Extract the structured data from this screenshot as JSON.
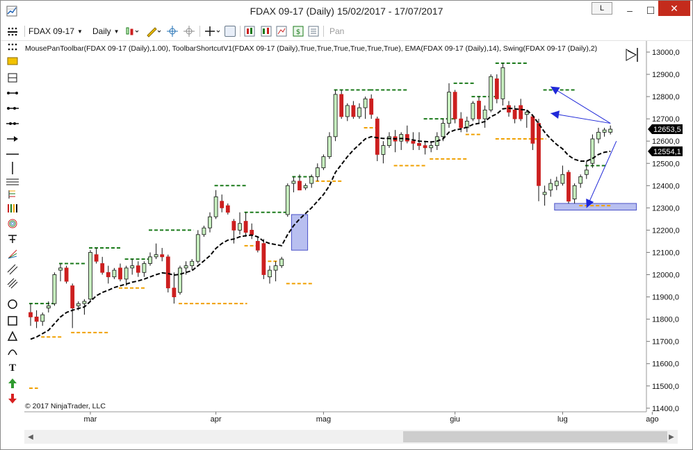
{
  "window": {
    "title": "FDAX 09-17 (Daily)  15/02/2017 - 17/07/2017",
    "btn_l": "L",
    "minimize": "–",
    "maximize": "☐",
    "close": "✕"
  },
  "toolbar": {
    "instrument": "FDAX 09-17",
    "period": "Daily",
    "pan": "Pan"
  },
  "chart": {
    "indicators": "MousePanToolbar(FDAX 09-17 (Daily),1.00), ToolbarShortcutV1(FDAX 09-17 (Daily),True,True,True,True,True,True), EMA(FDAX 09-17 (Daily),14), Swing(FDAX 09-17 (Daily),2)",
    "copyright": "© 2017 NinjaTrader, LLC",
    "price_ticks": [
      "13000,0",
      "12900,0",
      "12800,0",
      "12700,0",
      "12600,0",
      "12500,0",
      "12400,0",
      "12300,0",
      "12200,0",
      "12100,0",
      "12000,0",
      "11900,0",
      "11800,0",
      "11700,0",
      "11600,0",
      "11500,0",
      "11400,0"
    ],
    "month_labels": [
      "mar",
      "apr",
      "mag",
      "giu",
      "lug",
      "ago"
    ],
    "last_price_label": "12653,5",
    "ema_label": "12554,1",
    "colors": {
      "up_candle": "#c8f0c0",
      "down_candle": "#cc1f1f",
      "swing_high": "#1a7a1a",
      "swing_low": "#f0a000",
      "ema": "#000000",
      "annotation": "#1f28d8",
      "box": "#b8bff0",
      "price_marker": "#000000"
    }
  },
  "chart_data": {
    "type": "candlestick",
    "x_range": [
      "15/02/2017",
      "17/07/2017"
    ],
    "ylim": [
      11400,
      13030
    ],
    "candles": [
      {
        "o": 11830,
        "h": 11870,
        "l": 11770,
        "c": 11810
      },
      {
        "o": 11810,
        "h": 11840,
        "l": 11760,
        "c": 11790
      },
      {
        "o": 11790,
        "h": 11830,
        "l": 11770,
        "c": 11820
      },
      {
        "o": 11850,
        "h": 11880,
        "l": 11830,
        "c": 11860
      },
      {
        "o": 11870,
        "h": 12010,
        "l": 11860,
        "c": 12000
      },
      {
        "o": 12020,
        "h": 12050,
        "l": 11970,
        "c": 12030
      },
      {
        "o": 12030,
        "h": 12040,
        "l": 11960,
        "c": 11970
      },
      {
        "o": 11950,
        "h": 11960,
        "l": 11760,
        "c": 11850
      },
      {
        "o": 11860,
        "h": 11880,
        "l": 11840,
        "c": 11870
      },
      {
        "o": 11870,
        "h": 11890,
        "l": 11820,
        "c": 11880
      },
      {
        "o": 11890,
        "h": 12110,
        "l": 11880,
        "c": 12100
      },
      {
        "o": 12090,
        "h": 12120,
        "l": 12050,
        "c": 12060
      },
      {
        "o": 12050,
        "h": 12080,
        "l": 12000,
        "c": 12010
      },
      {
        "o": 12010,
        "h": 12040,
        "l": 11960,
        "c": 11990
      },
      {
        "o": 11990,
        "h": 12030,
        "l": 11980,
        "c": 12020
      },
      {
        "o": 12030,
        "h": 12050,
        "l": 11970,
        "c": 11980
      },
      {
        "o": 11980,
        "h": 12040,
        "l": 11950,
        "c": 12030
      },
      {
        "o": 12030,
        "h": 12070,
        "l": 12000,
        "c": 12040
      },
      {
        "o": 12040,
        "h": 12060,
        "l": 11990,
        "c": 12010
      },
      {
        "o": 12010,
        "h": 12060,
        "l": 11990,
        "c": 12050
      },
      {
        "o": 12050,
        "h": 12100,
        "l": 12040,
        "c": 12080
      },
      {
        "o": 12080,
        "h": 12140,
        "l": 12070,
        "c": 12090
      },
      {
        "o": 12090,
        "h": 12120,
        "l": 12060,
        "c": 12080
      },
      {
        "o": 12080,
        "h": 12090,
        "l": 11920,
        "c": 11940
      },
      {
        "o": 11940,
        "h": 12010,
        "l": 11870,
        "c": 11900
      },
      {
        "o": 11920,
        "h": 12040,
        "l": 11910,
        "c": 12030
      },
      {
        "o": 12030,
        "h": 12060,
        "l": 12000,
        "c": 12040
      },
      {
        "o": 12040,
        "h": 12070,
        "l": 12020,
        "c": 12060
      },
      {
        "o": 12060,
        "h": 12200,
        "l": 12050,
        "c": 12180
      },
      {
        "o": 12180,
        "h": 12220,
        "l": 12170,
        "c": 12210
      },
      {
        "o": 12210,
        "h": 12280,
        "l": 12190,
        "c": 12260
      },
      {
        "o": 12260,
        "h": 12380,
        "l": 12250,
        "c": 12350
      },
      {
        "o": 12330,
        "h": 12360,
        "l": 12280,
        "c": 12300
      },
      {
        "o": 12310,
        "h": 12320,
        "l": 12270,
        "c": 12280
      },
      {
        "o": 12240,
        "h": 12250,
        "l": 12140,
        "c": 12200
      },
      {
        "o": 12200,
        "h": 12280,
        "l": 12180,
        "c": 12230
      },
      {
        "o": 12240,
        "h": 12280,
        "l": 12170,
        "c": 12190
      },
      {
        "o": 12200,
        "h": 12230,
        "l": 12160,
        "c": 12180
      },
      {
        "o": 12150,
        "h": 12170,
        "l": 12100,
        "c": 12110
      },
      {
        "o": 12140,
        "h": 12160,
        "l": 11980,
        "c": 12000
      },
      {
        "o": 11990,
        "h": 12040,
        "l": 11960,
        "c": 12020
      },
      {
        "o": 12020,
        "h": 12060,
        "l": 11970,
        "c": 12040
      },
      {
        "o": 12040,
        "h": 12080,
        "l": 12030,
        "c": 12070
      },
      {
        "o": 12270,
        "h": 12410,
        "l": 12260,
        "c": 12400
      },
      {
        "o": 12410,
        "h": 12440,
        "l": 12370,
        "c": 12420
      },
      {
        "o": 12420,
        "h": 12450,
        "l": 12380,
        "c": 12380
      },
      {
        "o": 12390,
        "h": 12410,
        "l": 12380,
        "c": 12400
      },
      {
        "o": 12410,
        "h": 12450,
        "l": 12390,
        "c": 12440
      },
      {
        "o": 12440,
        "h": 12500,
        "l": 12420,
        "c": 12480
      },
      {
        "o": 12480,
        "h": 12540,
        "l": 12470,
        "c": 12530
      },
      {
        "o": 12530,
        "h": 12640,
        "l": 12520,
        "c": 12620
      },
      {
        "o": 12620,
        "h": 12830,
        "l": 12600,
        "c": 12810
      },
      {
        "o": 12810,
        "h": 12830,
        "l": 12700,
        "c": 12710
      },
      {
        "o": 12710,
        "h": 12770,
        "l": 12690,
        "c": 12760
      },
      {
        "o": 12760,
        "h": 12780,
        "l": 12700,
        "c": 12710
      },
      {
        "o": 12710,
        "h": 12770,
        "l": 12700,
        "c": 12750
      },
      {
        "o": 12750,
        "h": 12800,
        "l": 12700,
        "c": 12790
      },
      {
        "o": 12790,
        "h": 12810,
        "l": 12700,
        "c": 12720
      },
      {
        "o": 12700,
        "h": 12710,
        "l": 12510,
        "c": 12540
      },
      {
        "o": 12540,
        "h": 12600,
        "l": 12500,
        "c": 12580
      },
      {
        "o": 12580,
        "h": 12640,
        "l": 12570,
        "c": 12620
      },
      {
        "o": 12620,
        "h": 12650,
        "l": 12550,
        "c": 12600
      },
      {
        "o": 12600,
        "h": 12640,
        "l": 12560,
        "c": 12630
      },
      {
        "o": 12630,
        "h": 12670,
        "l": 12590,
        "c": 12600
      },
      {
        "o": 12600,
        "h": 12640,
        "l": 12560,
        "c": 12590
      },
      {
        "o": 12590,
        "h": 12640,
        "l": 12560,
        "c": 12580
      },
      {
        "o": 12580,
        "h": 12600,
        "l": 12540,
        "c": 12570
      },
      {
        "o": 12570,
        "h": 12600,
        "l": 12550,
        "c": 12580
      },
      {
        "o": 12580,
        "h": 12640,
        "l": 12560,
        "c": 12620
      },
      {
        "o": 12620,
        "h": 12700,
        "l": 12600,
        "c": 12680
      },
      {
        "o": 12680,
        "h": 12860,
        "l": 12660,
        "c": 12820
      },
      {
        "o": 12820,
        "h": 12830,
        "l": 12680,
        "c": 12700
      },
      {
        "o": 12700,
        "h": 12730,
        "l": 12640,
        "c": 12660
      },
      {
        "o": 12660,
        "h": 12710,
        "l": 12640,
        "c": 12690
      },
      {
        "o": 12700,
        "h": 12780,
        "l": 12690,
        "c": 12770
      },
      {
        "o": 12780,
        "h": 12800,
        "l": 12680,
        "c": 12700
      },
      {
        "o": 12700,
        "h": 12760,
        "l": 12660,
        "c": 12740
      },
      {
        "o": 12740,
        "h": 12900,
        "l": 12730,
        "c": 12890
      },
      {
        "o": 12880,
        "h": 12900,
        "l": 12770,
        "c": 12790
      },
      {
        "o": 12790,
        "h": 12950,
        "l": 12760,
        "c": 12930
      },
      {
        "o": 12760,
        "h": 12780,
        "l": 12710,
        "c": 12730
      },
      {
        "o": 12740,
        "h": 12760,
        "l": 12680,
        "c": 12700
      },
      {
        "o": 12760,
        "h": 12790,
        "l": 12690,
        "c": 12700
      },
      {
        "o": 12720,
        "h": 12740,
        "l": 12660,
        "c": 12730
      },
      {
        "o": 12710,
        "h": 12720,
        "l": 12560,
        "c": 12590
      },
      {
        "o": 12680,
        "h": 12700,
        "l": 12330,
        "c": 12400
      },
      {
        "o": 12360,
        "h": 12400,
        "l": 12310,
        "c": 12370
      },
      {
        "o": 12380,
        "h": 12430,
        "l": 12350,
        "c": 12410
      },
      {
        "o": 12400,
        "h": 12440,
        "l": 12380,
        "c": 12420
      },
      {
        "o": 12410,
        "h": 12490,
        "l": 12400,
        "c": 12450
      },
      {
        "o": 12460,
        "h": 12470,
        "l": 12320,
        "c": 12330
      },
      {
        "o": 12340,
        "h": 12410,
        "l": 12320,
        "c": 12400
      },
      {
        "o": 12410,
        "h": 12450,
        "l": 12390,
        "c": 12440
      },
      {
        "o": 12450,
        "h": 12510,
        "l": 12430,
        "c": 12470
      },
      {
        "o": 12500,
        "h": 12630,
        "l": 12480,
        "c": 12610
      },
      {
        "o": 12610,
        "h": 12660,
        "l": 12590,
        "c": 12640
      },
      {
        "o": 12640,
        "h": 12660,
        "l": 12620,
        "c": 12650
      },
      {
        "o": 12640,
        "h": 12670,
        "l": 12630,
        "c": 12653.5
      }
    ],
    "ema14": [
      11710,
      11720,
      11735,
      11750,
      11780,
      11810,
      11830,
      11840,
      11848,
      11855,
      11880,
      11905,
      11920,
      11930,
      11942,
      11950,
      11958,
      11966,
      11972,
      11980,
      11990,
      12000,
      12008,
      12005,
      11998,
      12002,
      12010,
      12018,
      12040,
      12062,
      12085,
      12118,
      12140,
      12155,
      12160,
      12170,
      12175,
      12178,
      12170,
      12150,
      12140,
      12135,
      12130,
      12180,
      12220,
      12250,
      12275,
      12300,
      12330,
      12360,
      12400,
      12460,
      12495,
      12530,
      12560,
      12585,
      12610,
      12620,
      12615,
      12612,
      12612,
      12610,
      12612,
      12610,
      12605,
      12600,
      12598,
      12596,
      12600,
      12610,
      12640,
      12650,
      12655,
      12662,
      12675,
      12680,
      12688,
      12710,
      12722,
      12745,
      12748,
      12745,
      12742,
      12740,
      12715,
      12678,
      12640,
      12610,
      12585,
      12565,
      12535,
      12518,
      12510,
      12510,
      12522,
      12540,
      12550,
      12554.1
    ],
    "swing_highs": [
      {
        "price": 11870,
        "from": 0,
        "to": 4
      },
      {
        "price": 12050,
        "from": 5,
        "to": 9
      },
      {
        "price": 12120,
        "from": 10,
        "to": 15
      },
      {
        "price": 12070,
        "from": 16,
        "to": 20
      },
      {
        "price": 12200,
        "from": 20,
        "to": 27
      },
      {
        "price": 12400,
        "from": 31,
        "to": 36
      },
      {
        "price": 12280,
        "from": 36,
        "to": 43
      },
      {
        "price": 12440,
        "from": 44,
        "to": 47
      },
      {
        "price": 12830,
        "from": 51,
        "to": 57
      },
      {
        "price": 12830,
        "from": 57,
        "to": 63
      },
      {
        "price": 12700,
        "from": 66,
        "to": 71
      },
      {
        "price": 12860,
        "from": 71,
        "to": 74
      },
      {
        "price": 12800,
        "from": 74,
        "to": 78
      },
      {
        "price": 12950,
        "from": 78,
        "to": 83
      },
      {
        "price": 12830,
        "from": 86,
        "to": 91
      },
      {
        "price": 12490,
        "from": 93,
        "to": 96
      }
    ],
    "swing_lows": [
      {
        "price": 11490,
        "from": 0,
        "to": 1
      },
      {
        "price": 11720,
        "from": 2,
        "to": 5
      },
      {
        "price": 11740,
        "from": 7,
        "to": 13
      },
      {
        "price": 11940,
        "from": 15,
        "to": 19
      },
      {
        "price": 11870,
        "from": 25,
        "to": 36
      },
      {
        "price": 12130,
        "from": 36,
        "to": 38
      },
      {
        "price": 12060,
        "from": 39,
        "to": 41
      },
      {
        "price": 11960,
        "from": 43,
        "to": 47
      },
      {
        "price": 12420,
        "from": 47,
        "to": 52
      },
      {
        "price": 12660,
        "from": 56,
        "to": 58
      },
      {
        "price": 12490,
        "from": 61,
        "to": 66
      },
      {
        "price": 12520,
        "from": 67,
        "to": 73
      },
      {
        "price": 12630,
        "from": 73,
        "to": 75
      },
      {
        "price": 12610,
        "from": 78,
        "to": 86
      },
      {
        "price": 12310,
        "from": 92,
        "to": 97
      }
    ],
    "boxes": [
      {
        "from_index": 44,
        "to_index": 46,
        "low": 12110,
        "high": 12270
      },
      {
        "from_index": 88,
        "to_index": 101,
        "low": 12290,
        "high": 12320
      }
    ]
  }
}
